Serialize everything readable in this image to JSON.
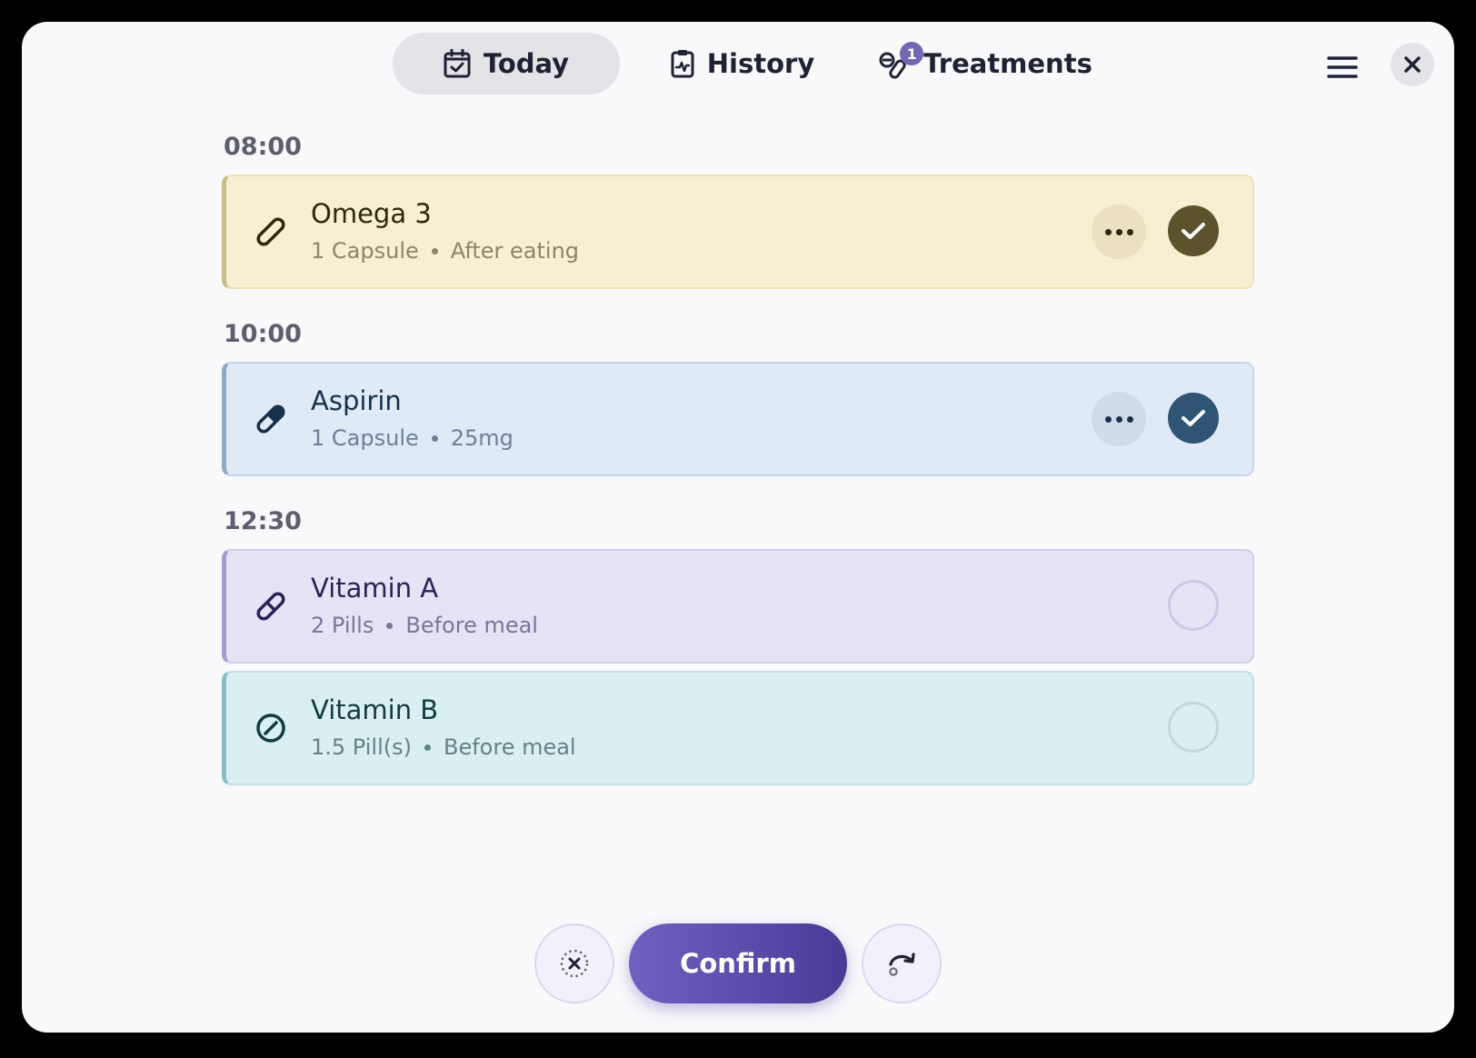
{
  "tabs": {
    "today": {
      "label": "Today",
      "icon": "calendar-check-icon",
      "active": true
    },
    "history": {
      "label": "History",
      "icon": "clipboard-pulse-icon"
    },
    "treatments": {
      "label": "Treatments",
      "icon": "pills-icon",
      "badge": "1"
    }
  },
  "header": {
    "menu_icon": "hamburger-menu-icon",
    "close_icon": "close-icon"
  },
  "schedule": [
    {
      "time": "08:00",
      "items": [
        {
          "name": "Omega 3",
          "dose": "1 Capsule",
          "note": "After eating",
          "taken": true,
          "color": "#f7efd2",
          "icon": "capsule-icon"
        }
      ]
    },
    {
      "time": "10:00",
      "items": [
        {
          "name": "Aspirin",
          "dose": "1 Capsule",
          "note": "25mg",
          "taken": true,
          "color": "#e0e9f6",
          "icon": "capsule-half-icon"
        }
      ]
    },
    {
      "time": "12:30",
      "items": [
        {
          "name": "Vitamin A",
          "dose": "2 Pills",
          "note": "Before meal",
          "taken": false,
          "color": "#e7e3f6",
          "icon": "capsule-outline-icon"
        },
        {
          "name": "Vitamin B",
          "dose": "1.5 Pill(s)",
          "note": "Before meal",
          "taken": false,
          "color": "#daeff2",
          "icon": "tablet-icon"
        }
      ]
    }
  ],
  "actions": {
    "skip_icon": "skip-dose-icon",
    "confirm_label": "Confirm",
    "snooze_icon": "snooze-icon",
    "accent": "#5a48a8"
  }
}
